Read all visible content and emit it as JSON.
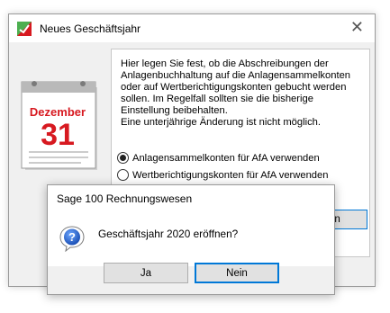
{
  "main_window": {
    "title": "Neues Geschäftsjahr",
    "close_glyph": "✕",
    "calendar": {
      "month": "Dezember",
      "day": "31"
    },
    "description": "Hier legen Sie fest, ob die Abschreibungen der Anlagenbuchhaltung auf die Anlagensammelkonten oder auf Wertberichtigungskonten gebucht werden sollen. Im Regelfall sollten sie die bisherige Einstellung beibehalten.\nEine unterjährige Änderung ist nicht möglich.",
    "options": [
      {
        "label": "Anlagensammelkonten für AfA verwenden",
        "selected": true
      },
      {
        "label": "Wertberichtigungskonten für AfA verwenden",
        "selected": false
      }
    ],
    "partial_button_label": "en"
  },
  "dialog": {
    "title": "Sage 100 Rechnungswesen",
    "message": "Geschäftsjahr 2020 eröffnen?",
    "icon": "question-icon",
    "buttons": {
      "yes": "Ja",
      "no": "Nein"
    }
  },
  "colors": {
    "accent": "#0078d7",
    "window_bg": "#f0f0f0",
    "calendar_red": "#d71920",
    "app_icon_green": "#4caf50"
  }
}
